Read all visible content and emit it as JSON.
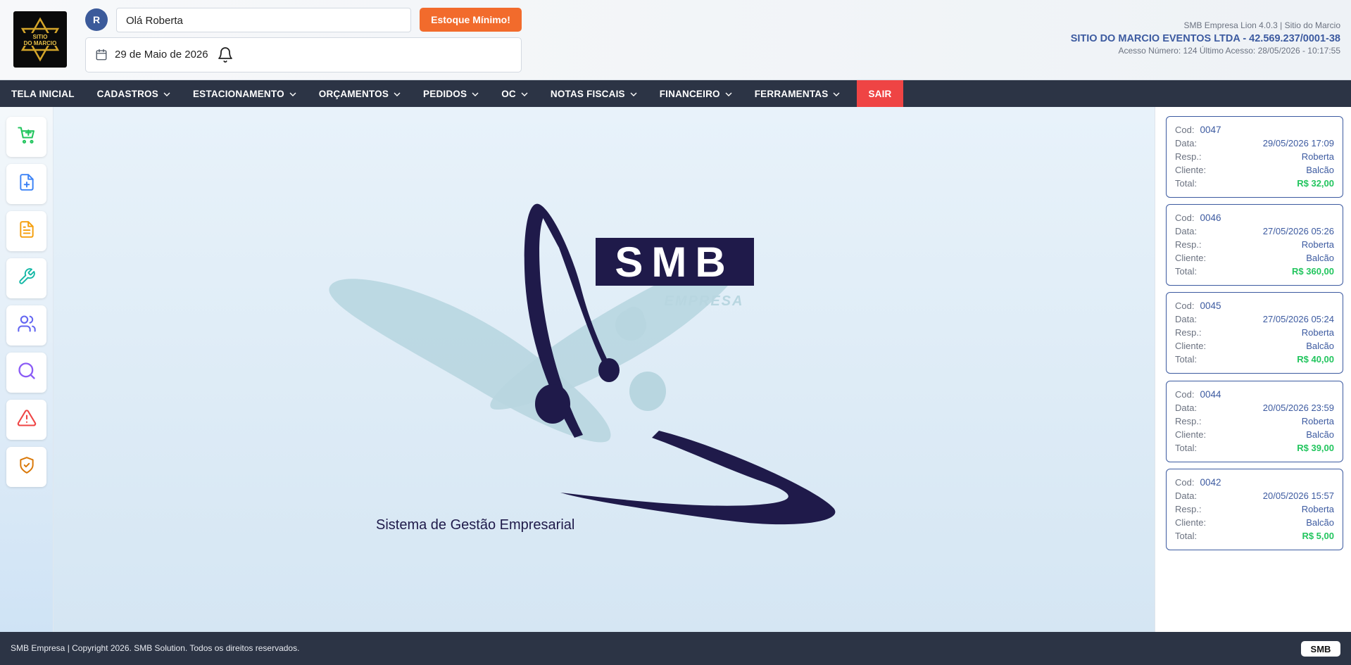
{
  "header": {
    "logo_text": "SITIO DO MARCIO",
    "avatar_letter": "R",
    "greeting": "Olá Roberta",
    "estoque_button": "Estoque Mínimo!",
    "date": "29 de Maio de 2026",
    "system_version": "SMB Empresa Lion 4.0.3 | Sitio do Marcio",
    "company": "SITIO DO MARCIO EVENTOS LTDA - 42.569.237/0001-38",
    "access": "Acesso Número: 124 Último Acesso: 28/05/2026 - 10:17:55"
  },
  "nav": [
    {
      "label": "TELA INICIAL",
      "dropdown": false
    },
    {
      "label": "CADASTROS",
      "dropdown": true
    },
    {
      "label": "ESTACIONAMENTO",
      "dropdown": true
    },
    {
      "label": "ORÇAMENTOS",
      "dropdown": true
    },
    {
      "label": "PEDIDOS",
      "dropdown": true
    },
    {
      "label": "OC",
      "dropdown": true
    },
    {
      "label": "NOTAS FISCAIS",
      "dropdown": true
    },
    {
      "label": "FINANCEIRO",
      "dropdown": true
    },
    {
      "label": "FERRAMENTAS",
      "dropdown": true
    },
    {
      "label": "SAIR",
      "dropdown": false
    }
  ],
  "sidebar": [
    {
      "icon": "cart-plus-icon",
      "color": "#22c55e"
    },
    {
      "icon": "file-plus-icon",
      "color": "#3b82f6"
    },
    {
      "icon": "file-text-icon",
      "color": "#f59e0b"
    },
    {
      "icon": "wrench-icon",
      "color": "#14b8a6"
    },
    {
      "icon": "users-icon",
      "color": "#6366f1"
    },
    {
      "icon": "search-icon",
      "color": "#8b5cf6"
    },
    {
      "icon": "alert-triangle-icon",
      "color": "#ef4444"
    },
    {
      "icon": "shield-check-icon",
      "color": "#d97706"
    }
  ],
  "brand": {
    "name": "SMB",
    "sub": "EMPRESA",
    "tagline": "Sistema de Gestão Empresarial"
  },
  "labels": {
    "cod": "Cod:",
    "data": "Data:",
    "resp": "Resp.:",
    "cliente": "Cliente:",
    "total": "Total:"
  },
  "orders": [
    {
      "cod": "0047",
      "data": "29/05/2026 17:09",
      "resp": "Roberta",
      "cliente": "Balcão",
      "total": "R$ 32,00"
    },
    {
      "cod": "0046",
      "data": "27/05/2026 05:26",
      "resp": "Roberta",
      "cliente": "Balcão",
      "total": "R$ 360,00"
    },
    {
      "cod": "0045",
      "data": "27/05/2026 05:24",
      "resp": "Roberta",
      "cliente": "Balcão",
      "total": "R$ 40,00"
    },
    {
      "cod": "0044",
      "data": "20/05/2026 23:59",
      "resp": "Roberta",
      "cliente": "Balcão",
      "total": "R$ 39,00"
    },
    {
      "cod": "0042",
      "data": "20/05/2026 15:57",
      "resp": "Roberta",
      "cliente": "Balcão",
      "total": "R$ 5,00"
    }
  ],
  "footer": {
    "copyright": "SMB Empresa | Copyright 2026. SMB Solution. Todos os direitos reservados.",
    "badge": "SMB"
  },
  "colors": {
    "nav_bg": "#2c3445",
    "accent_blue": "#3c5aa0",
    "orange": "#f26b2c",
    "sair_red": "#ef4444",
    "total_green": "#22c55e",
    "logo_navy": "#1f1a4a",
    "logo_light": "#b8d6e0"
  }
}
